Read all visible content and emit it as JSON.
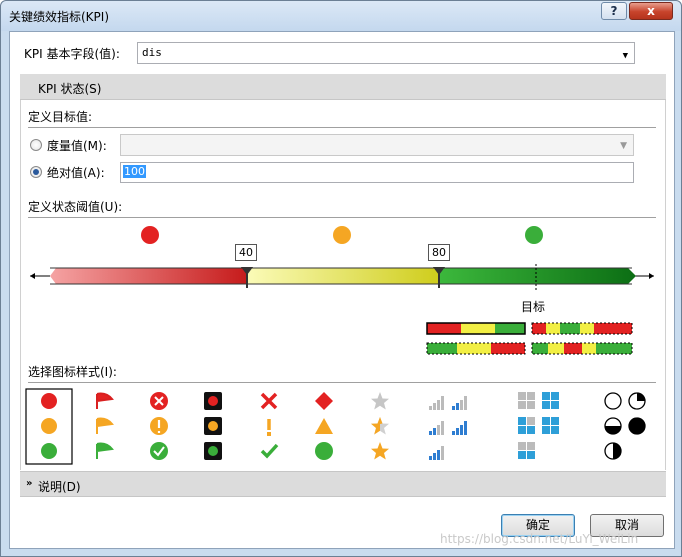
{
  "window": {
    "title": "关键绩效指标(KPI)",
    "help_label": "?",
    "close_label": "x"
  },
  "kpi_field": {
    "label": "KPI 基本字段(值):",
    "value": "dis"
  },
  "status_section": {
    "label": "KPI 状态(S)"
  },
  "target": {
    "group_label": "定义目标值:",
    "measure_label": "度量值(M):",
    "measure_value": "",
    "absolute_label": "绝对值(A):",
    "absolute_value": "100",
    "selected": "absolute"
  },
  "threshold": {
    "group_label": "定义状态阈值(U):",
    "values": [
      "40",
      "80"
    ],
    "target_label": "目标",
    "colors": {
      "red": "#e32222",
      "orange": "#f5a623",
      "green": "#3aae3a",
      "yellow": "#f2ef44"
    }
  },
  "icon_styles": {
    "label": "选择图标样式(I):",
    "sets": [
      "circles",
      "flags",
      "symbols-circled",
      "traffic-lights",
      "symbols",
      "shapes",
      "stars",
      "bars",
      "boxes",
      "pies"
    ]
  },
  "description_section": {
    "label": "说明(D)"
  },
  "buttons": {
    "ok": "确定",
    "cancel": "取消"
  },
  "watermark": "https://blog.csdn.net/LuYi_WeiLin"
}
